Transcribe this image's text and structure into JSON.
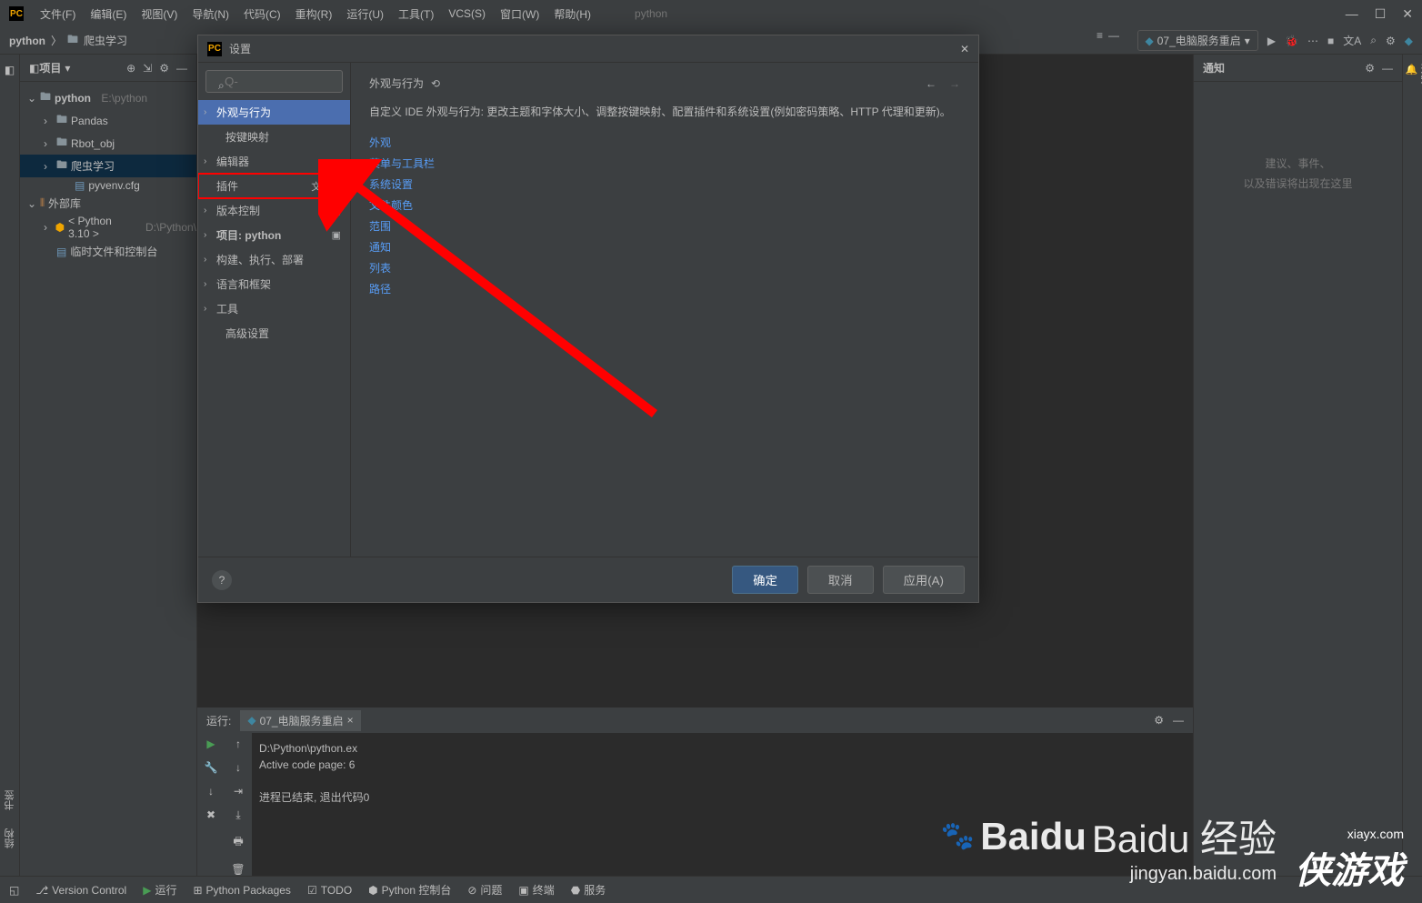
{
  "titlebar": {
    "logo": "PC",
    "menus": [
      "文件(F)",
      "编辑(E)",
      "视图(V)",
      "导航(N)",
      "代码(C)",
      "重构(R)",
      "运行(U)",
      "工具(T)",
      "VCS(S)",
      "窗口(W)",
      "帮助(H)"
    ],
    "app_title": "python"
  },
  "navbar": {
    "breadcrumb": [
      "python",
      "爬虫学习"
    ],
    "run_config": "07_电脑服务重启"
  },
  "project": {
    "title": "项目",
    "tree": {
      "root": "python",
      "root_path": "E:\\python",
      "items": [
        "Pandas",
        "Rbot_obj",
        "爬虫学习",
        "pyvenv.cfg"
      ],
      "ext_lib": "外部库",
      "py_ver": "< Python 3.10 >",
      "py_path": "D:\\Python\\",
      "scratch": "临时文件和控制台"
    }
  },
  "notifications": {
    "title": "通知",
    "line1": "建议、事件、",
    "line2": "以及错误将出现在这里"
  },
  "run": {
    "label": "运行:",
    "tab": "07_电脑服务重启",
    "output_l1": "D:\\Python\\python.ex",
    "output_l2": "Active code page: 6",
    "output_l3": "进程已结束, 退出代码0"
  },
  "statusbar": {
    "items": [
      "Version Control",
      "运行",
      "Python Packages",
      "TODO",
      "Python 控制台",
      "问题",
      "终端",
      "服务"
    ]
  },
  "dialog": {
    "title": "设置",
    "search_placeholder": "Q-",
    "sidebar": {
      "appearance": "外观与行为",
      "keymap": "按键映射",
      "editor": "编辑器",
      "plugins": "插件",
      "vcs": "版本控制",
      "project": "项目: python",
      "build": "构建、执行、部署",
      "lang": "语言和框架",
      "tools": "工具",
      "advanced": "高级设置"
    },
    "content": {
      "heading": "外观与行为",
      "desc": "自定义 IDE 外观与行为: 更改主题和字体大小、调整按键映射、配置插件和系统设置(例如密码策略、HTTP 代理和更新)。",
      "links": [
        "外观",
        "菜单与工具栏",
        "系统设置",
        "文件颜色",
        "范围",
        "通知",
        "列表",
        "路径"
      ]
    },
    "footer": {
      "ok": "确定",
      "cancel": "取消",
      "apply": "应用(A)"
    }
  },
  "left_gutter": {
    "structure": "结构",
    "bookmarks": "书签"
  },
  "right_gutter": {
    "notifications": "通知"
  },
  "watermark": {
    "baidu": "Baidu 经验",
    "baidu_url": "jingyan.baidu.com",
    "xiayx": "侠游戏",
    "xiayx_url": "xiayx.com"
  }
}
